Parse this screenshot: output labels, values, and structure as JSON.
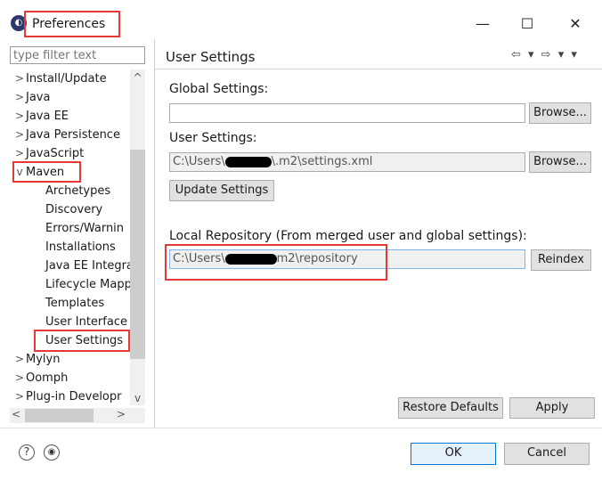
{
  "window": {
    "title": "Preferences",
    "minimize": "—",
    "maximize": "☐",
    "close": "✕"
  },
  "filter": {
    "placeholder": "type filter text"
  },
  "tree": {
    "items": [
      {
        "label": "Install/Update",
        "chev": ">"
      },
      {
        "label": "Java",
        "chev": ">"
      },
      {
        "label": "Java EE",
        "chev": ">"
      },
      {
        "label": "Java Persistence",
        "chev": ">"
      },
      {
        "label": "JavaScript",
        "chev": ">"
      },
      {
        "label": "Maven",
        "chev": "v"
      },
      {
        "label": "Archetypes"
      },
      {
        "label": "Discovery"
      },
      {
        "label": "Errors/Warnin"
      },
      {
        "label": "Installations"
      },
      {
        "label": "Java EE Integra"
      },
      {
        "label": "Lifecycle Mapp"
      },
      {
        "label": "Templates"
      },
      {
        "label": "User Interface"
      },
      {
        "label": "User Settings"
      },
      {
        "label": "Mylyn",
        "chev": ">"
      },
      {
        "label": "Oomph",
        "chev": ">"
      },
      {
        "label": "Plug-in Developr",
        "chev": ">"
      }
    ],
    "scroll_up": "^",
    "scroll_down": "v",
    "scroll_left": "<",
    "scroll_right": ">"
  },
  "panel": {
    "title": "User Settings",
    "nav": "⇦ ▾ ⇨ ▾ ▾",
    "global_label": "Global Settings:",
    "global_value": "",
    "browse": "Browse...",
    "user_label": "User Settings:",
    "user_value_prefix": "C:\\Users\\",
    "user_value_suffix": "\\.m2\\settings.xml",
    "update_settings": "Update Settings",
    "local_label": "Local Repository (From merged user and global settings):",
    "local_value_prefix": "C:\\Users\\",
    "local_value_suffix": "m2\\repository",
    "reindex": "Reindex",
    "restore_defaults": "Restore Defaults",
    "apply": "Apply"
  },
  "footer": {
    "help_icon": "?",
    "import_icon": "◉",
    "ok": "OK",
    "cancel": "Cancel"
  },
  "colors": {
    "highlight_red": "#e53935",
    "primary_border": "#0078d7"
  }
}
